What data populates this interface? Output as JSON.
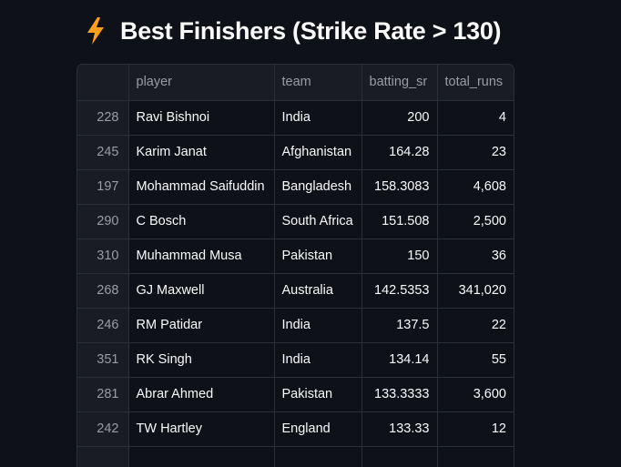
{
  "title": {
    "icon": "lightning-bolt-icon",
    "text": "Best Finishers (Strike Rate > 130)"
  },
  "colors": {
    "background": "#0e1117",
    "header_bg": "#1a1c24",
    "border": "#2b2f3a",
    "text": "#fafafa",
    "muted_text": "#9a9ca3",
    "bolt": "#ff9f1c"
  },
  "table": {
    "columns": [
      "",
      "player",
      "team",
      "batting_sr",
      "total_runs"
    ],
    "rows": [
      {
        "index": "228",
        "player": "Ravi Bishnoi",
        "team": "India",
        "batting_sr": "200",
        "total_runs": "4"
      },
      {
        "index": "245",
        "player": "Karim Janat",
        "team": "Afghanistan",
        "batting_sr": "164.28",
        "total_runs": "23"
      },
      {
        "index": "197",
        "player": "Mohammad Saifuddin",
        "team": "Bangladesh",
        "batting_sr": "158.3083",
        "total_runs": "4,608"
      },
      {
        "index": "290",
        "player": "C Bosch",
        "team": "South Africa",
        "batting_sr": "151.508",
        "total_runs": "2,500"
      },
      {
        "index": "310",
        "player": "Muhammad Musa",
        "team": "Pakistan",
        "batting_sr": "150",
        "total_runs": "36"
      },
      {
        "index": "268",
        "player": "GJ Maxwell",
        "team": "Australia",
        "batting_sr": "142.5353",
        "total_runs": "341,020"
      },
      {
        "index": "246",
        "player": "RM Patidar",
        "team": "India",
        "batting_sr": "137.5",
        "total_runs": "22"
      },
      {
        "index": "351",
        "player": "RK Singh",
        "team": "India",
        "batting_sr": "134.14",
        "total_runs": "55"
      },
      {
        "index": "281",
        "player": "Abrar Ahmed",
        "team": "Pakistan",
        "batting_sr": "133.3333",
        "total_runs": "3,600"
      },
      {
        "index": "242",
        "player": "TW Hartley",
        "team": "England",
        "batting_sr": "133.33",
        "total_runs": "12"
      }
    ]
  }
}
